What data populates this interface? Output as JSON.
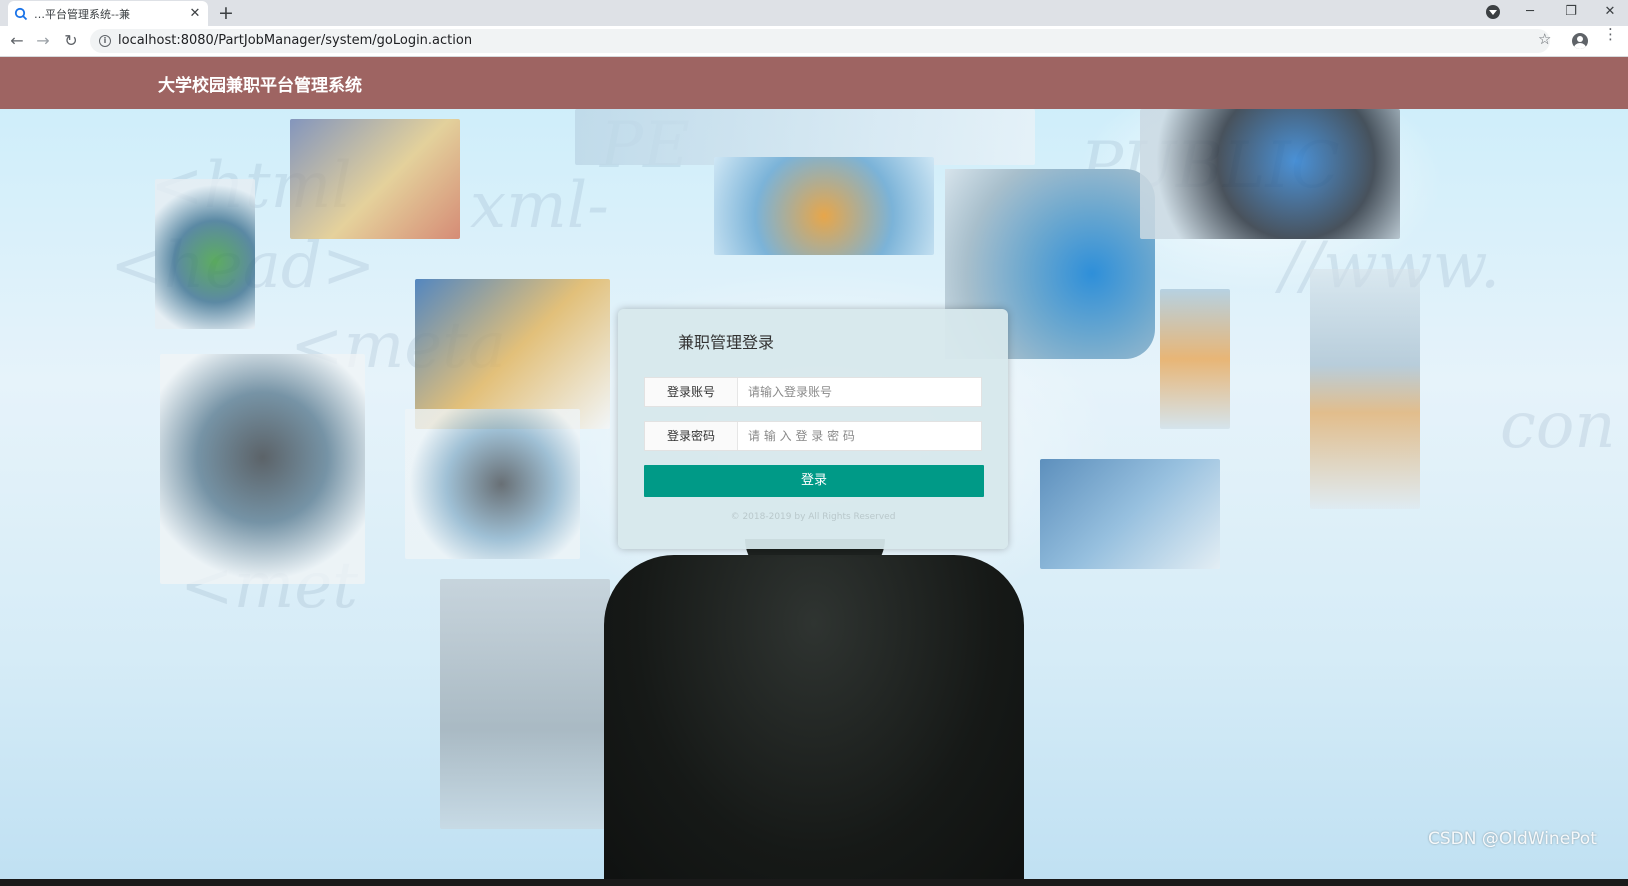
{
  "browser": {
    "tab_title": "…平台管理系统--兼",
    "tab_close": "✕",
    "new_tab": "+",
    "url": "localhost:8080/PartJobManager/system/goLogin.action",
    "back": "←",
    "forward": "→",
    "reload": "↻",
    "star": "☆",
    "menu": "⋮",
    "win_min": "─",
    "win_restore": "❐",
    "win_close": "✕"
  },
  "header": {
    "title": "大学校园兼职平台管理系统"
  },
  "login": {
    "heading": "兼职管理登录",
    "account_label": "登录账号",
    "account_placeholder": "请输入登录账号",
    "password_label": "登录密码",
    "password_placeholder": "请 输 入 登 录 密 码",
    "submit_label": "登录",
    "copyright": "© 2018-2019 by All Rights Reserved"
  },
  "background_text": [
    "<html",
    "xml-",
    "<head>",
    "PE",
    "PUBLIC",
    "//www.",
    "<meta",
    "<met",
    "con"
  ],
  "watermark": "CSDN @OldWinePot",
  "colors": {
    "header_bg": "#9e6462",
    "button_bg": "#009a87",
    "panel_bg": "#d7e8ec"
  }
}
